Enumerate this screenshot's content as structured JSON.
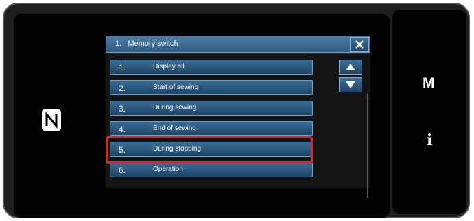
{
  "dialog": {
    "title": "1.   Memory switch"
  },
  "menu": {
    "items": [
      {
        "number": "1.",
        "label": "Display all"
      },
      {
        "number": "2.",
        "label": "Start of sewing"
      },
      {
        "number": "3.",
        "label": "During sewing"
      },
      {
        "number": "4.",
        "label": "End of sewing"
      },
      {
        "number": "5.",
        "label": "During stopping"
      },
      {
        "number": "6.",
        "label": "Operation"
      }
    ],
    "highlighted_index": 4
  },
  "side_panel": {
    "m_key": "M",
    "info_key": "i"
  },
  "icons": {
    "close": "close-icon",
    "scroll_up": "triangle-up-icon",
    "scroll_down": "triangle-down-icon",
    "nfc": "nfc-icon"
  },
  "colors": {
    "button_blue": "#2e5a80",
    "highlight_red": "#e0222e",
    "screen_black": "#000000"
  }
}
